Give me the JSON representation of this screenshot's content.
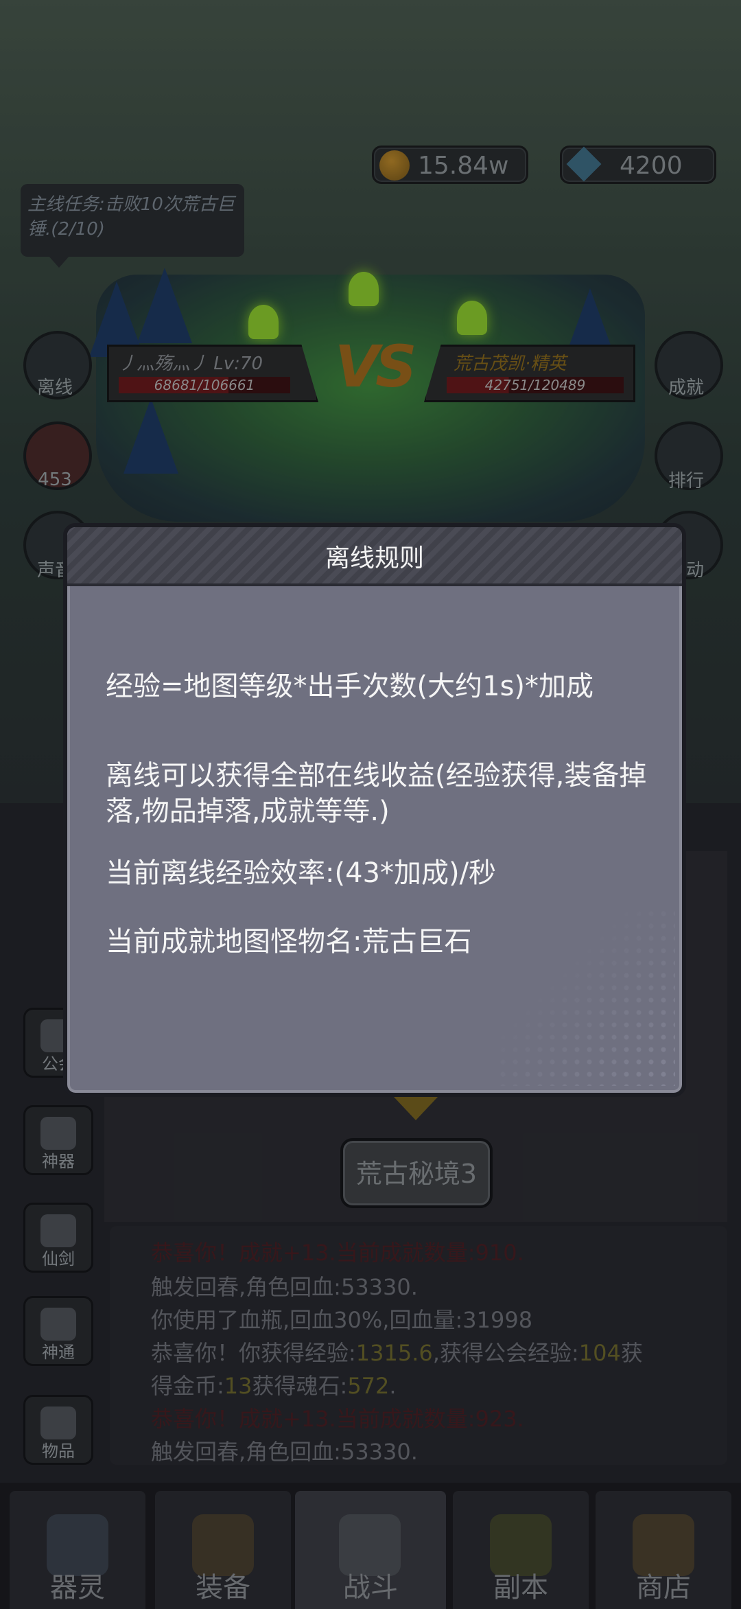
{
  "hud": {
    "gold": "15.84w",
    "gems": "4200",
    "quest": "主线任务:击败10次荒古巨锤.(2/10)"
  },
  "side_left": [
    {
      "label": "离线"
    },
    {
      "label": "453"
    },
    {
      "label": "声音"
    }
  ],
  "side_right": [
    {
      "label": "成就"
    },
    {
      "label": "排行"
    },
    {
      "label": "活动"
    }
  ],
  "battle": {
    "player_name": "丿灬殇灬丿 Lv:70",
    "player_hp": "68681/106661",
    "player_hp_fraction": 0.64,
    "vs": "VS",
    "enemy_name": "荒古茂凯·精英",
    "enemy_hp": "42751/120489",
    "enemy_hp_fraction": 0.35
  },
  "left_tabs": [
    {
      "label": "公会"
    },
    {
      "label": "神器"
    },
    {
      "label": "仙剑"
    },
    {
      "label": "神通"
    },
    {
      "label": "物品"
    }
  ],
  "map_button": "荒古秘境3",
  "battle_log": {
    "line1": "恭喜你！成就+13.当前成就数量:910.",
    "line2": "触发回春,角色回血:53330.",
    "line3": "你使用了血瓶,回血30%,回血量:31998",
    "line4_a": "恭喜你！你获得经验:",
    "line4_b": "1315.6",
    "line4_c": ",获得公会经验:",
    "line4_d": "104",
    "line4_e": "获",
    "line5_a": "得金币:",
    "line5_b": "13",
    "line5_c": "获得魂石:",
    "line5_d": "572",
    "line5_e": ".",
    "line6": "恭喜你！成就+13.当前成就数量:923.",
    "line7": "触发回春,角色回血:53330."
  },
  "nav": [
    {
      "label": "器灵"
    },
    {
      "label": "装备"
    },
    {
      "label": "战斗"
    },
    {
      "label": "副本"
    },
    {
      "label": "商店"
    }
  ],
  "dialog": {
    "title": "离线规则",
    "line1": "经验=地图等级*出手次数(大约1s)*加成",
    "line2": "离线可以获得全部在线收益(经验获得,装备掉落,物品掉落,成就等等.)",
    "line3": "当前离线经验效率:(43*加成)/秒",
    "line4": "当前成就地图怪物名:荒古巨石"
  },
  "colors": {
    "dialog_bg": "#6f7080",
    "highlight_text": "#6f6a2e"
  }
}
